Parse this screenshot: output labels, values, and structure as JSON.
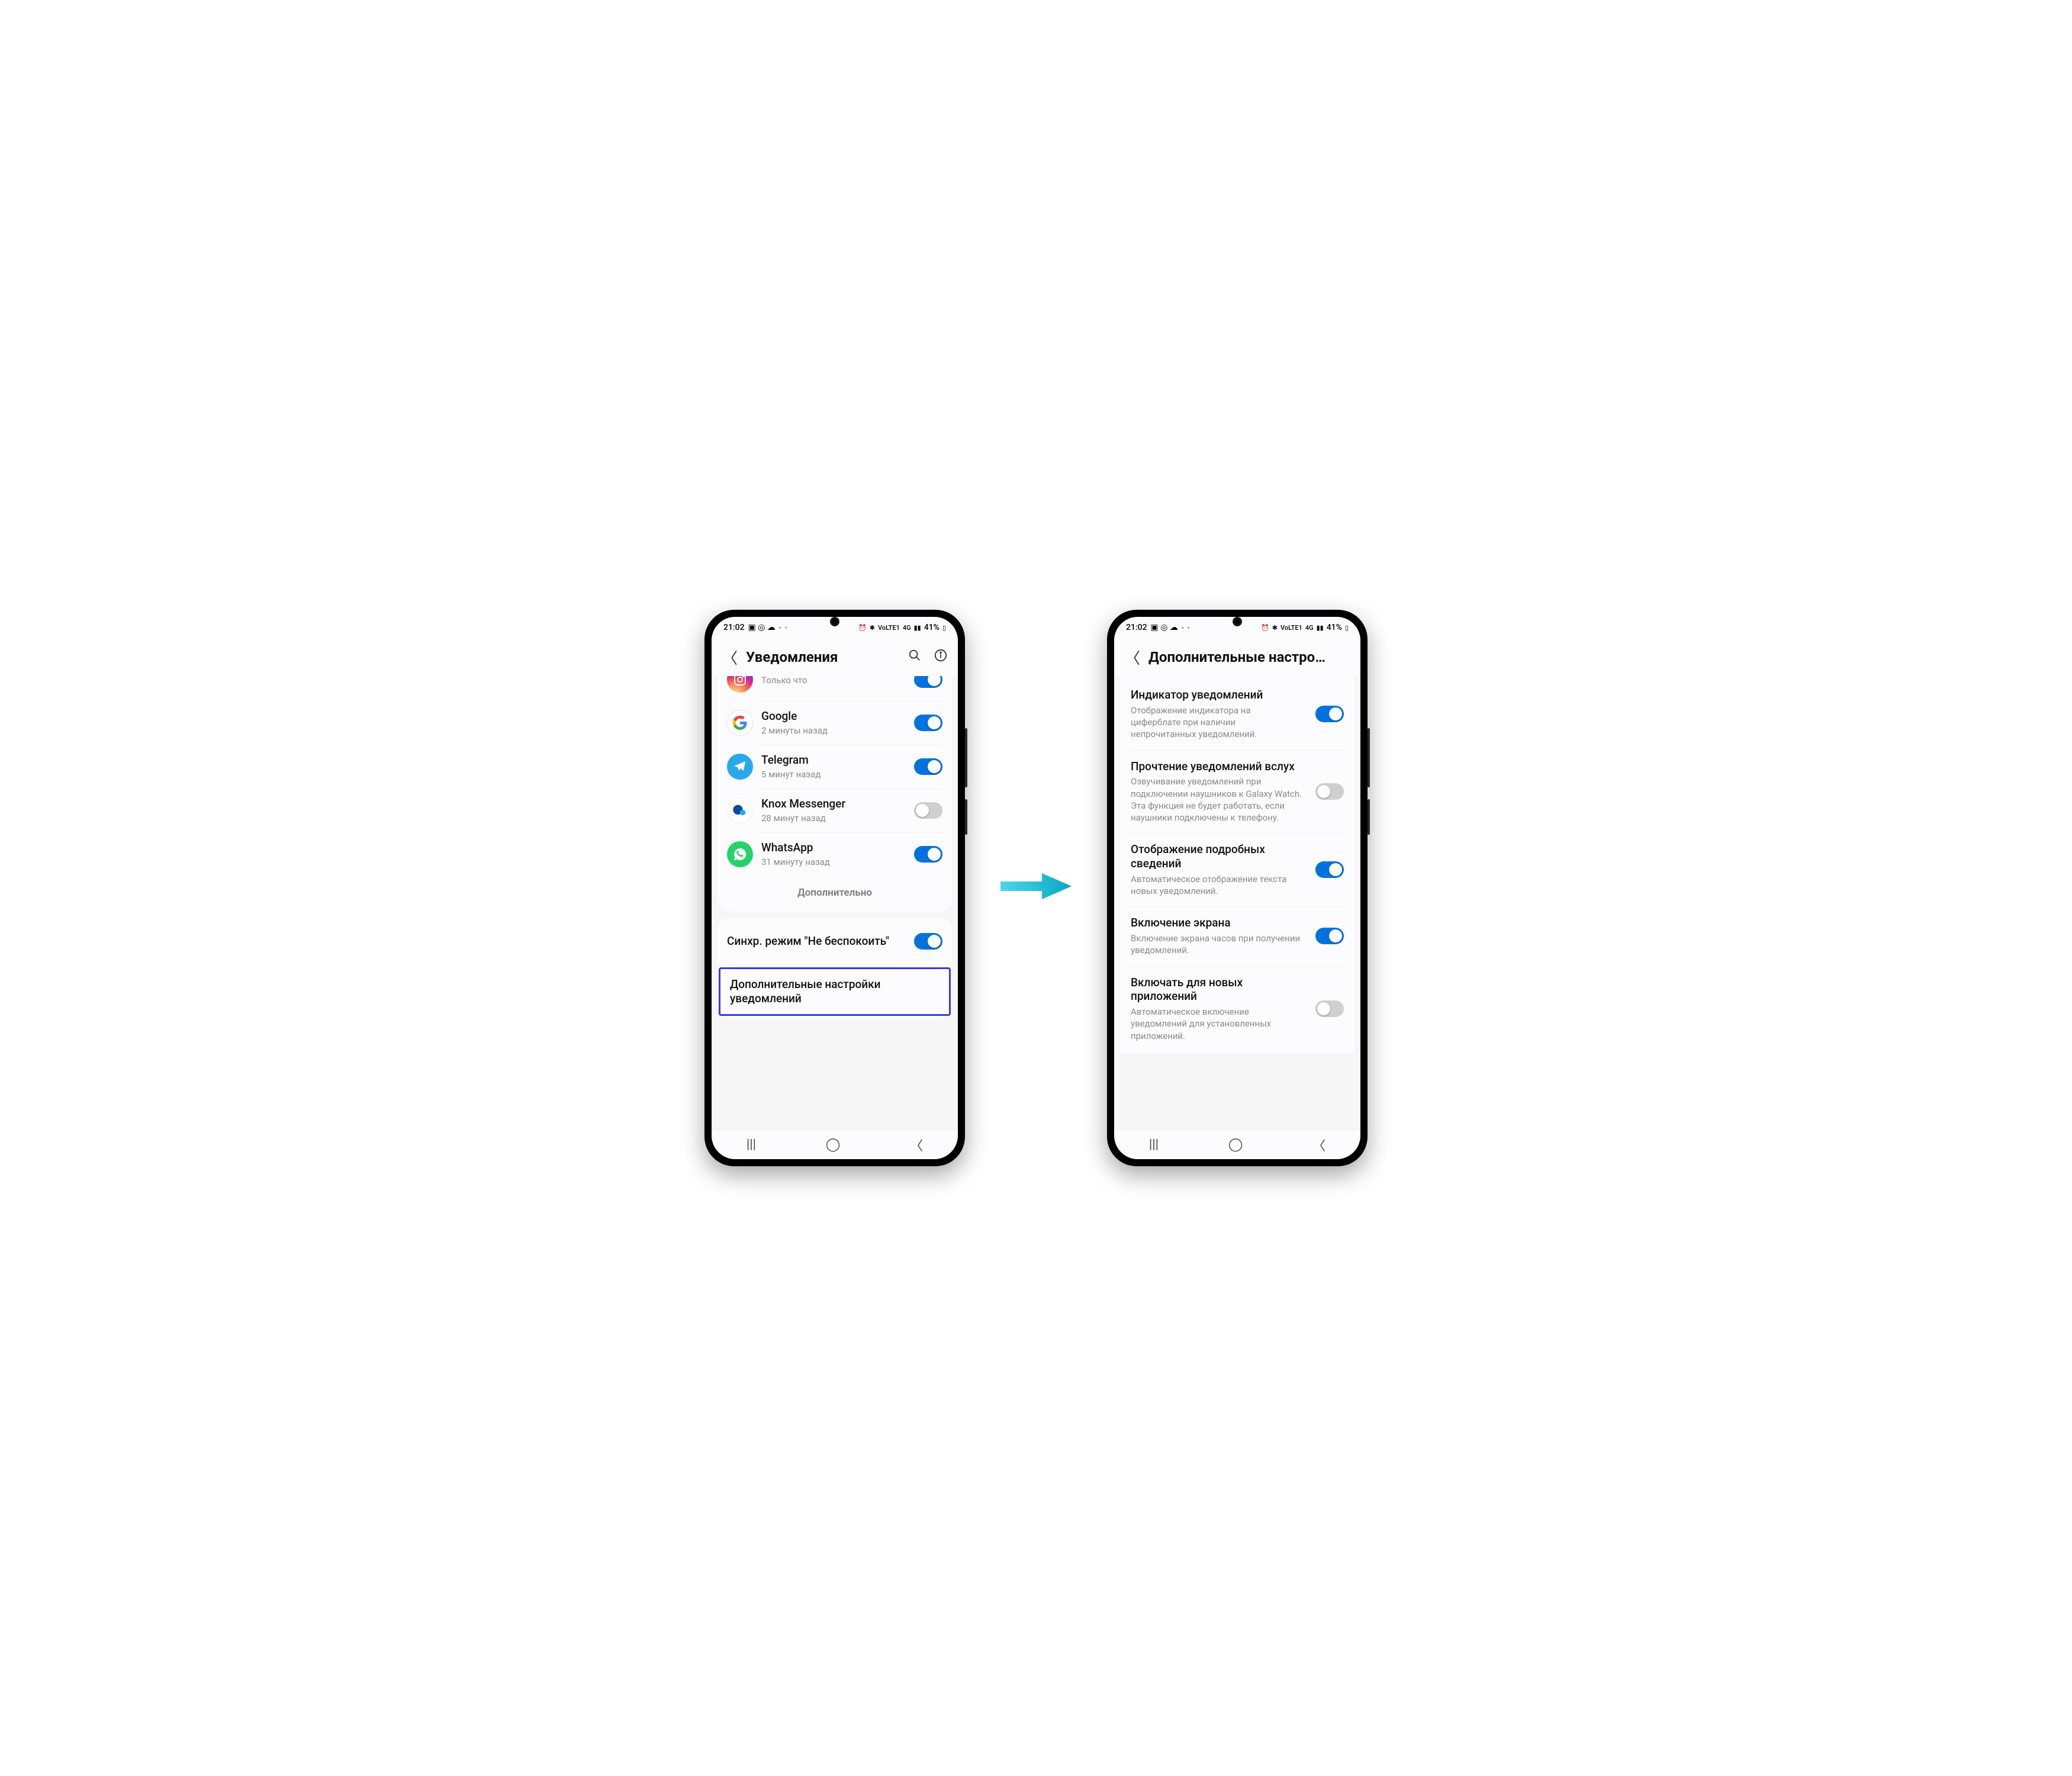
{
  "status": {
    "time": "21:02",
    "battery": "41%",
    "net": "4G",
    "lte": "VoLTE1"
  },
  "phone1": {
    "header": {
      "title": "Уведомления"
    },
    "apps": [
      {
        "name": "Instagram",
        "sub": "Только что",
        "icon": "instagram",
        "on": true,
        "cut": true
      },
      {
        "name": "Google",
        "sub": "2 минуты назад",
        "icon": "google",
        "on": true
      },
      {
        "name": "Telegram",
        "sub": "5 минут назад",
        "icon": "telegram",
        "on": true
      },
      {
        "name": "Knox Messenger",
        "sub": "28 минут назад",
        "icon": "knox",
        "on": false
      },
      {
        "name": "WhatsApp",
        "sub": "31 минуту назад",
        "icon": "whatsapp",
        "on": true
      }
    ],
    "more_label": "Дополнительно",
    "sync": {
      "title": "Синхр. режим \"Не беспокоить\"",
      "on": true
    },
    "advanced_label": "Дополнительные настройки уведомлений"
  },
  "phone2": {
    "header": {
      "title": "Дополнительные настро…"
    },
    "settings": [
      {
        "title": "Индикатор уведомлений",
        "sub": "Отображение индикатора на циферблате при наличии непрочитанных уведомлений.",
        "on": true
      },
      {
        "title": "Прочтение уведомлений вслух",
        "sub": "Озвучивание уведомлений при подключении наушников к Galaxy Watch. Эта функция не будет работать, если наушники подключены к телефону.",
        "on": false
      },
      {
        "title": "Отображение подробных сведений",
        "sub": "Автоматическое отображение текста новых уведомлений.",
        "on": true
      },
      {
        "title": "Включение экрана",
        "sub": "Включение экрана часов при получении уведомлений.",
        "on": true
      },
      {
        "title": "Включать для новых приложений",
        "sub": "Автоматическое включение уведомлений для установленных приложений.",
        "on": false
      }
    ]
  }
}
